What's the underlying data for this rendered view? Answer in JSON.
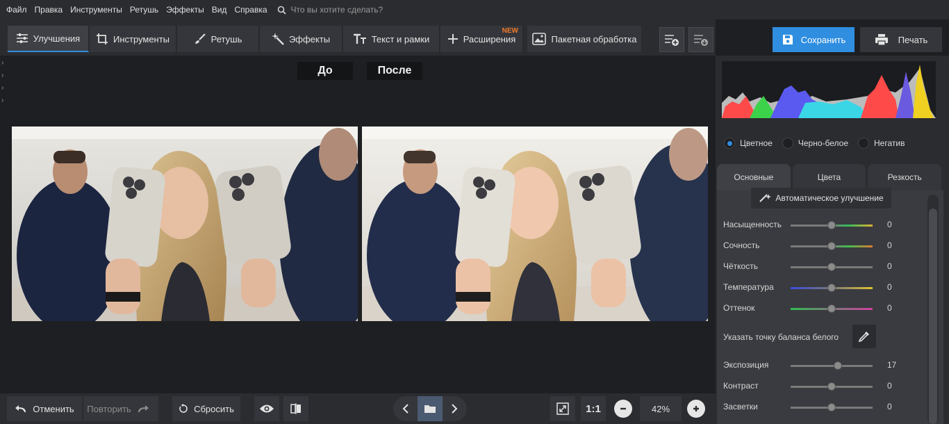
{
  "menu": {
    "items": [
      "Файл",
      "Правка",
      "Инструменты",
      "Ретушь",
      "Эффекты",
      "Вид",
      "Справка"
    ],
    "search_placeholder": "Что вы хотите сделать?"
  },
  "tabs": {
    "enhance": "Улучшения",
    "tools": "Инструменты",
    "retouch": "Ретушь",
    "effects": "Эффекты",
    "text": "Текст и рамки",
    "extensions": "Расширения",
    "new_badge": "NEW",
    "batch": "Пакетная обработка"
  },
  "actions": {
    "save": "Сохранить",
    "print": "Печать"
  },
  "compare": {
    "before": "До",
    "after": "После"
  },
  "bottom": {
    "undo": "Отменить",
    "redo": "Повторить",
    "reset": "Сбросить",
    "fit": "1:1",
    "zoom": "42%"
  },
  "modes": {
    "color": "Цветное",
    "bw": "Черно-белое",
    "negative": "Негатив",
    "selected": "color"
  },
  "panel_tabs": {
    "basic": "Основные",
    "colors": "Цвета",
    "sharpness": "Резкость"
  },
  "auto_enhance": "Автоматическое улучшение",
  "sliders": [
    {
      "label": "Насыщенность",
      "value": "0",
      "level": 0.5
    },
    {
      "label": "Сочность",
      "value": "0",
      "level": 0.5
    },
    {
      "label": "Чёткость",
      "value": "0",
      "level": 0.5
    },
    {
      "label": "Температура",
      "value": "0",
      "level": 0.5
    },
    {
      "label": "Оттенок",
      "value": "0",
      "level": 0.5
    }
  ],
  "white_balance": "Указать точку баланса белого",
  "sliders2": [
    {
      "label": "Экспозиция",
      "value": "17",
      "level": 0.58
    },
    {
      "label": "Контраст",
      "value": "0",
      "level": 0.5
    },
    {
      "label": "Засветки",
      "value": "0",
      "level": 0.5
    }
  ],
  "colors": {
    "accent": "#2f8ee0",
    "new_badge": "#f07a2a"
  }
}
